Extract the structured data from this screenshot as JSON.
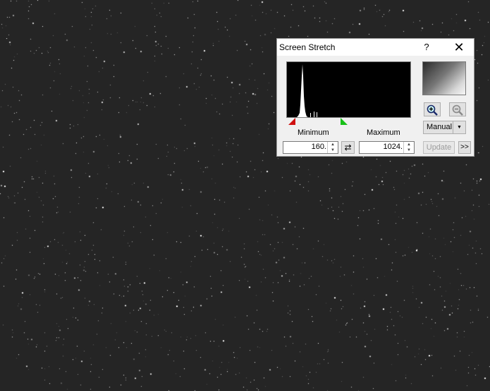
{
  "background": {
    "color": "#252525",
    "content": "starfield-image"
  },
  "dialog": {
    "title": "Screen Stretch",
    "help_label": "?",
    "close_icon": "close-icon",
    "labels": {
      "minimum": "Minimum",
      "maximum": "Maximum"
    },
    "minimum_value": "160.",
    "maximum_value": "1024.",
    "swap_icon": "swap-arrows-icon",
    "zoom_in_icon": "zoom-in-icon",
    "zoom_out_icon": "zoom-out-icon",
    "mode": "Manual",
    "update_label": "Update",
    "more_label": ">>",
    "colors": {
      "min_marker": "#d01010",
      "max_marker": "#18c018",
      "histogram": "#ffffff"
    }
  }
}
